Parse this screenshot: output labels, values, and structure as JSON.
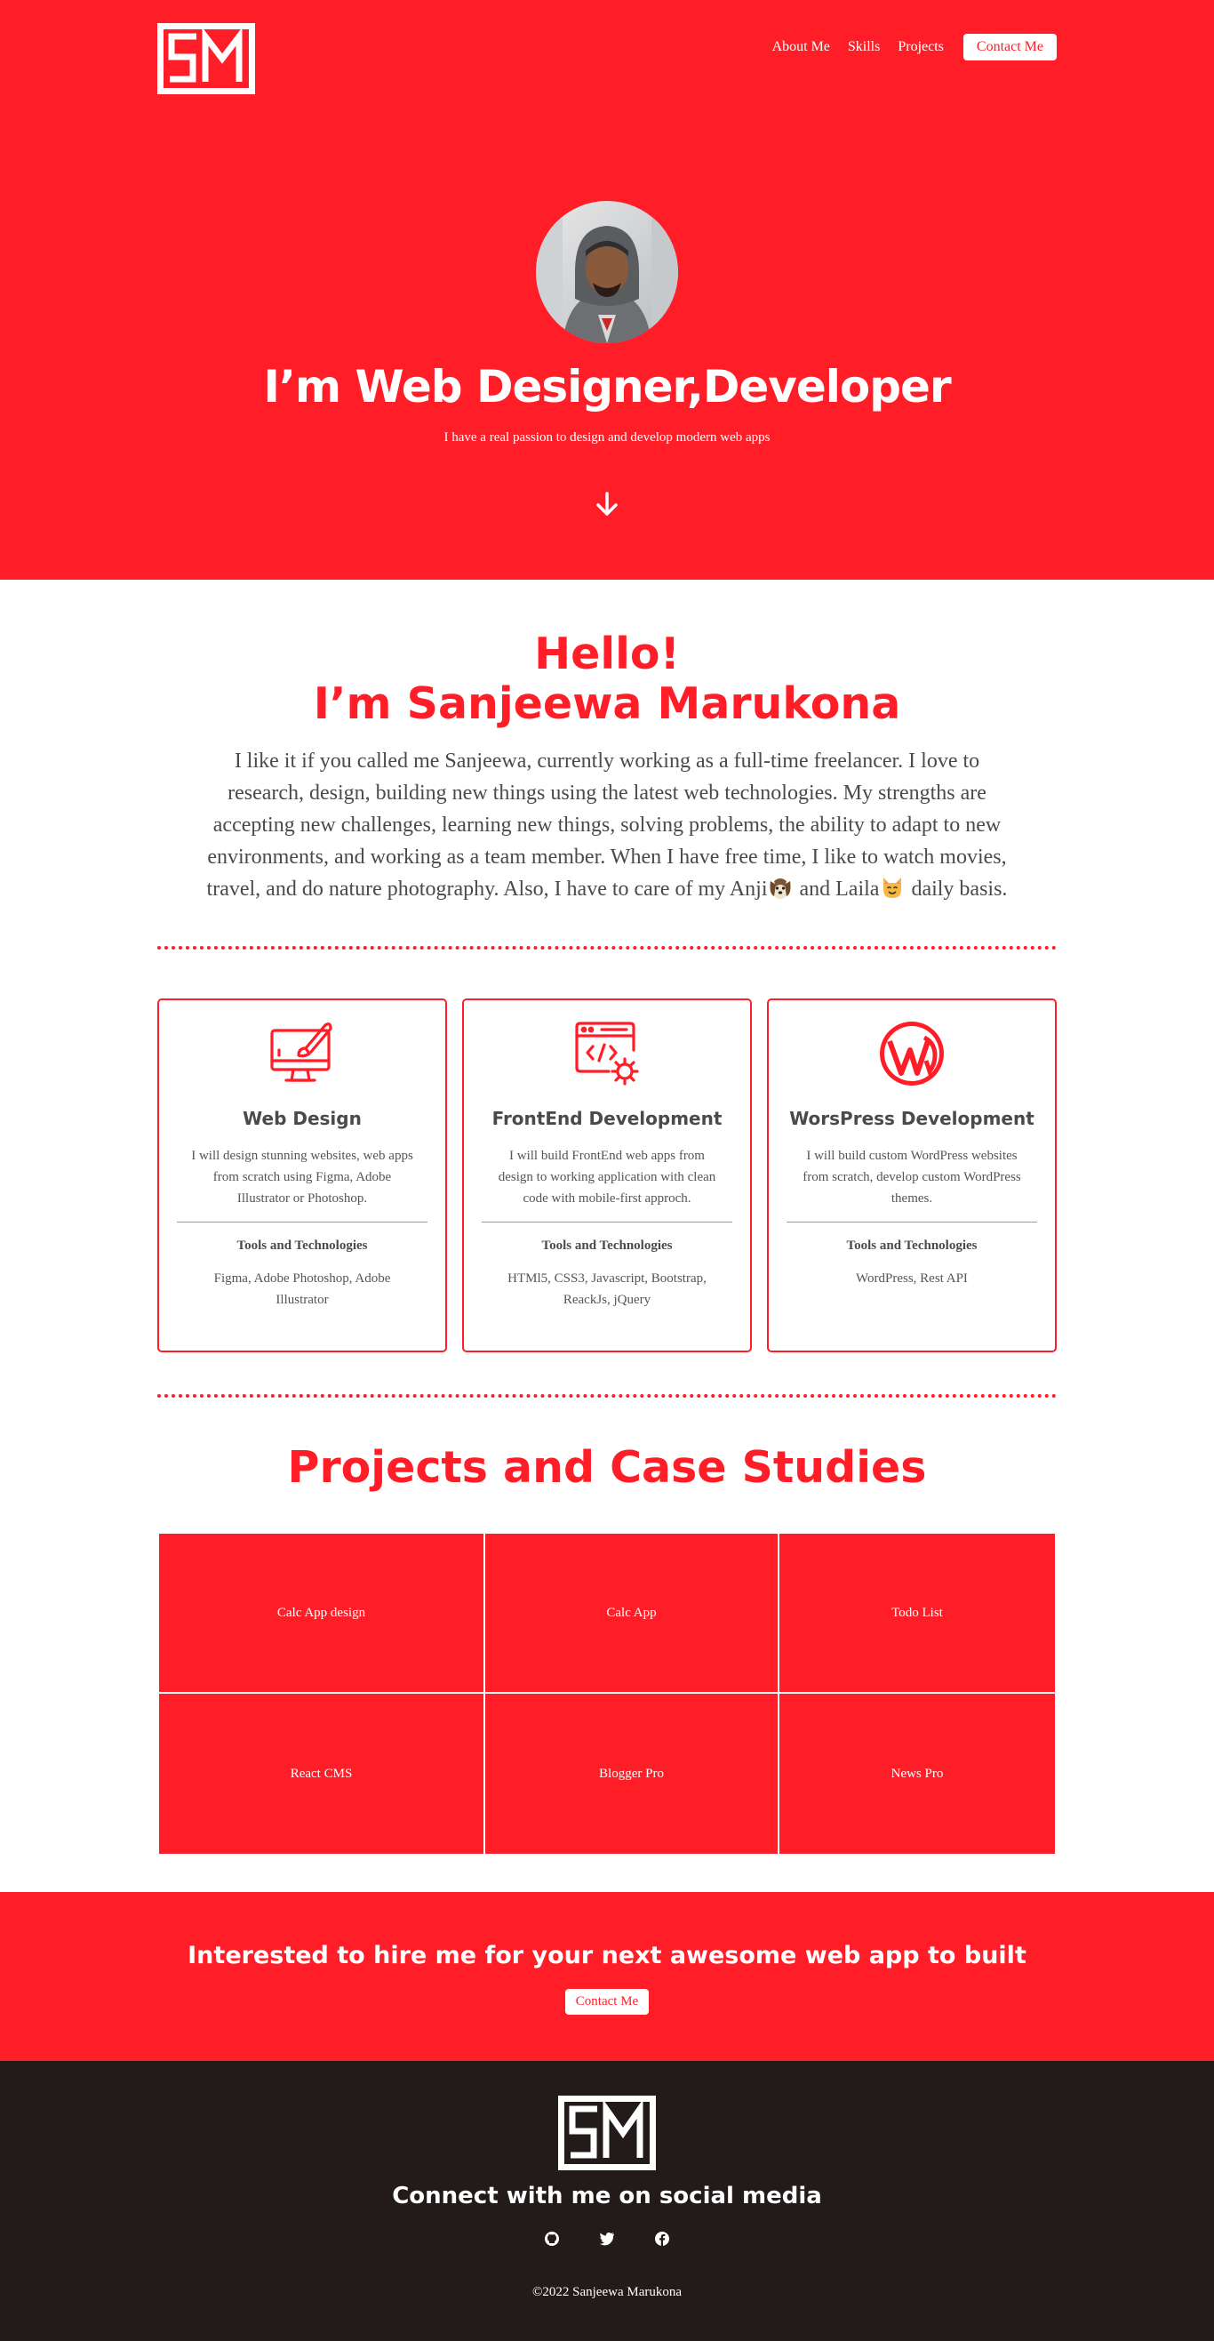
{
  "nav": {
    "items": [
      "About Me",
      "Skills",
      "Projects"
    ],
    "contact_label": "Contact Me"
  },
  "hero": {
    "title": "I’m Web Designer,Developer",
    "subtitle": "I have a real passion to design and develop modern web apps"
  },
  "about": {
    "greeting": "Hello!",
    "name_line": "I’m Sanjeewa Marukona",
    "paragraph": "I like it if you called me Sanjeewa, currently working as a full-time freelancer. I love to research, design, building new things using the latest web technologies. My strengths are accepting new challenges, learning new things, solving problems, the ability to adapt to new environments, and working as a team member. When I have free time, I like to watch movies, travel, and do nature photography. Also, I have to care of my Anji",
    "and_text": " and Laila",
    "end_text": " daily basis."
  },
  "services": [
    {
      "icon": "web-design-icon",
      "title": "Web Design",
      "description": "I will design stunning websites, web apps from scratch using Figma, Adobe Illustrator or Photoshop.",
      "tools_heading": "Tools and Technologies",
      "tools": "Figma, Adobe Photoshop, Adobe Illustrator"
    },
    {
      "icon": "code-gear-icon",
      "title": "FrontEnd Development",
      "description": "I will build FrontEnd web apps from design to working application with clean code with mobile-first approch.",
      "tools_heading": "Tools and Technologies",
      "tools": "HTMl5, CSS3, Javascript, Bootstrap, ReackJs, jQuery"
    },
    {
      "icon": "wordpress-icon",
      "title": "WorsPress Development",
      "description": "I will build custom WordPress websites from scratch, develop custom WordPress themes.",
      "tools_heading": "Tools and Technologies",
      "tools": "WordPress, Rest API"
    }
  ],
  "projects": {
    "title": "Projects and Case Studies",
    "items": [
      "Calc App design",
      "Calc App",
      "Todo List",
      "React CMS",
      "Blogger Pro",
      "News Pro"
    ]
  },
  "hire": {
    "title": "Interested to hire me for your next awesome web app to built",
    "button": "Contact Me"
  },
  "footer": {
    "title": "Connect with me on social media",
    "social_icons": [
      "github-icon",
      "twitter-icon",
      "facebook-icon"
    ],
    "copyright": "©2022 Sanjeewa Marukona"
  },
  "colors": {
    "brand_red": "#ff1e27",
    "footer_dark": "#231a1a",
    "text_gray": "#4a4a4a"
  }
}
